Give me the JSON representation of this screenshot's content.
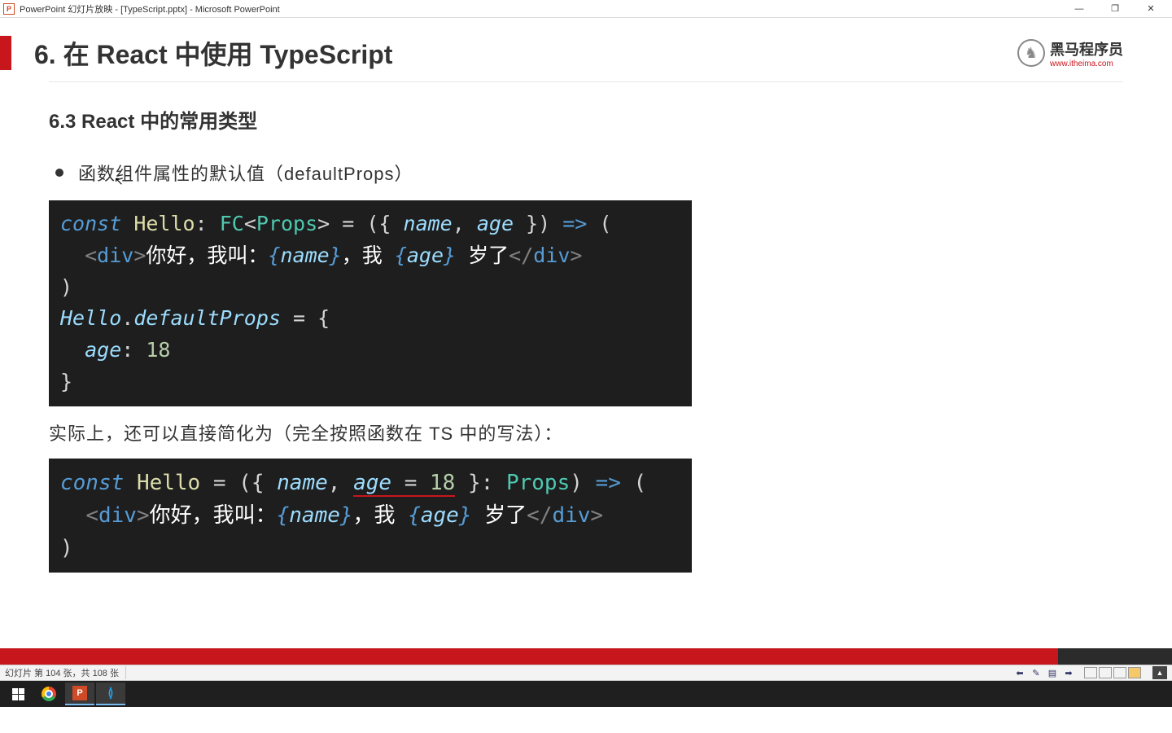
{
  "titlebar": {
    "icon_letter": "P",
    "text": "PowerPoint 幻灯片放映 - [TypeScript.pptx] - Microsoft PowerPoint"
  },
  "window_controls": {
    "min": "—",
    "max": "❐",
    "close": "✕"
  },
  "slide": {
    "title": "6. 在 React 中使用 TypeScript",
    "logo": {
      "brand": "黑马程序员",
      "url": "www.itheima.com"
    },
    "subtitle": "6.3 React 中的常用类型",
    "bullet": "函数组件属性的默认值（defaultProps）",
    "code1": {
      "l1": {
        "const": "const",
        "name": "Hello",
        "colon": ": ",
        "fc": "FC",
        "lt": "<",
        "props": "Props",
        "gt": ">",
        "eq": " = ({ ",
        "p1": "name",
        "comma": ", ",
        "p2": "age",
        "close": " }) ",
        "arrow": "=>",
        "paren": " ("
      },
      "l2": {
        "indent": "  ",
        "open": "<",
        "tag": "div",
        "close": ">",
        "txt1": "你好，我叫：",
        "lb1": "{",
        "v1": "name",
        "rb1": "}",
        "txt2": "，我 ",
        "lb2": "{",
        "v2": "age",
        "rb2": "}",
        "txt3": " 岁了",
        "copen": "</",
        "ctag": "div",
        "cclose": ">"
      },
      "l3": ")",
      "l4": {
        "obj": "Hello",
        "dot": ".",
        "prop": "defaultProps",
        "eq": " = {"
      },
      "l5": {
        "indent": "  ",
        "key": "age",
        "colon": ": ",
        "val": "18"
      },
      "l6": "}"
    },
    "mid_text": "实际上，还可以直接简化为（完全按照函数在 TS 中的写法）：",
    "code2": {
      "l1": {
        "const": "const",
        "name": "Hello",
        "eq": " = ({ ",
        "p1": "name",
        "comma": ", ",
        "p2": "age",
        "eqop": " = ",
        "val": "18",
        "close": " }: ",
        "props": "Props",
        "paren": ") ",
        "arrow": "=>",
        "open": " ("
      },
      "l2": {
        "indent": "  ",
        "open": "<",
        "tag": "div",
        "close": ">",
        "txt1": "你好，我叫：",
        "lb1": "{",
        "v1": "name",
        "rb1": "}",
        "txt2": "，我 ",
        "lb2": "{",
        "v2": "age",
        "rb2": "}",
        "txt3": " 岁了",
        "copen": "</",
        "ctag": "div",
        "cclose": ">"
      },
      "l3": ")"
    }
  },
  "statusbar": {
    "text": "幻灯片 第 104 张，共 108 张"
  },
  "taskbar": {
    "pp": "P"
  }
}
